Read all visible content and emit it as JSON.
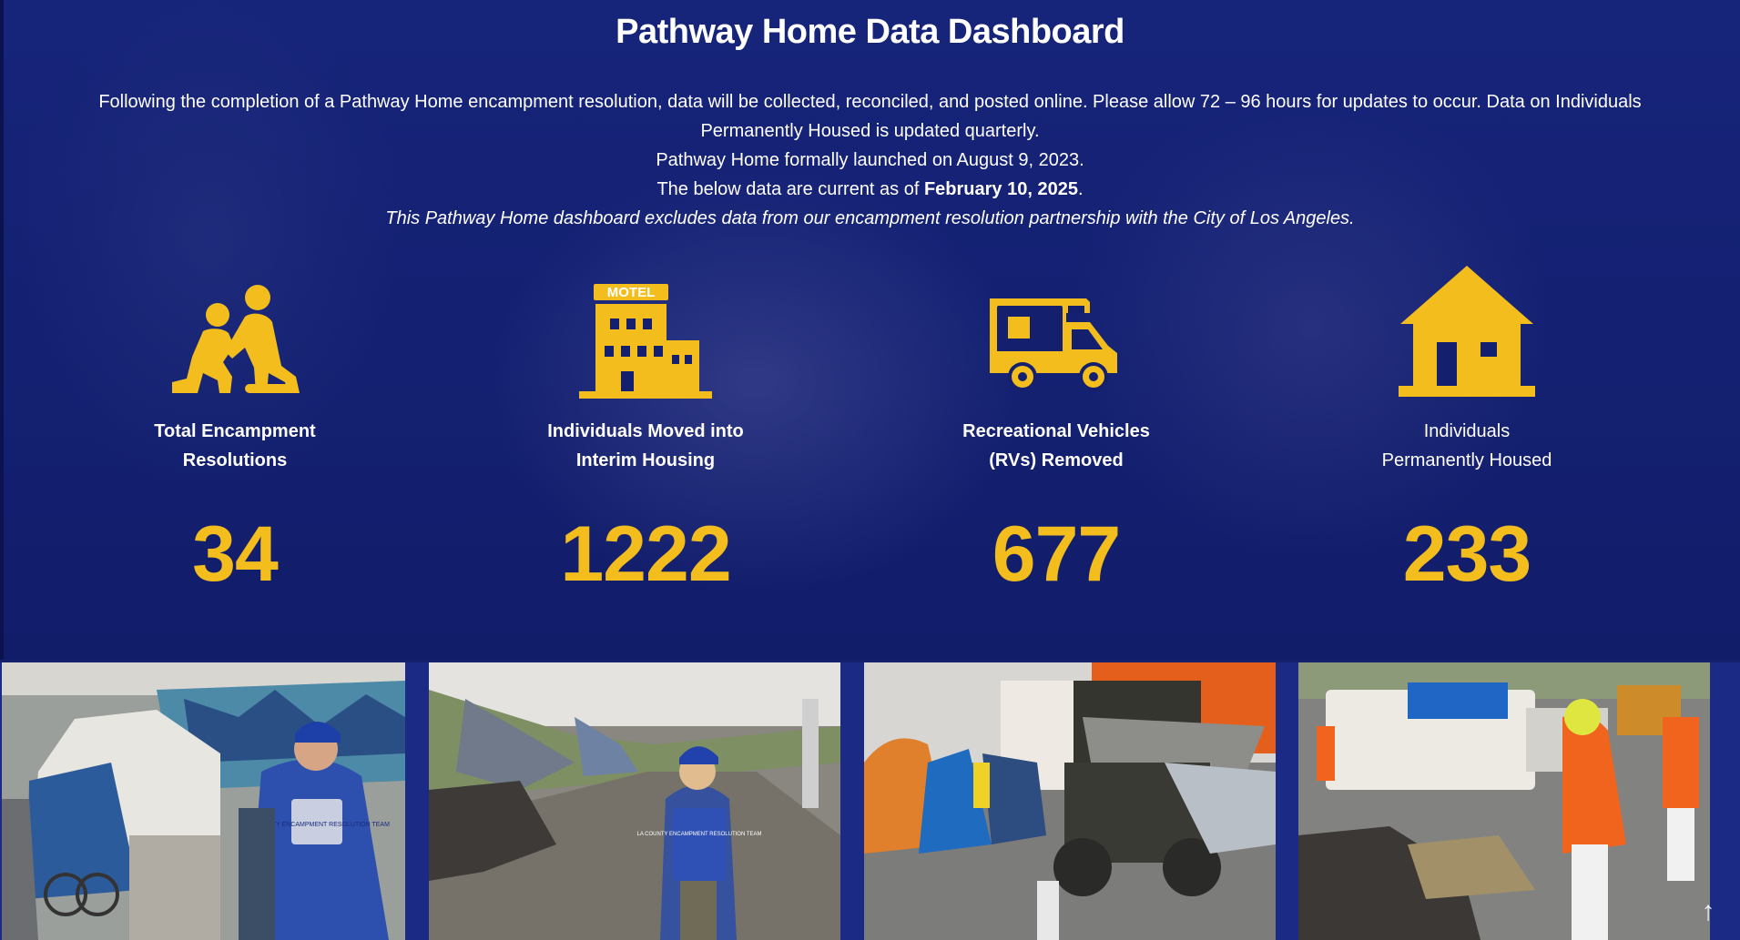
{
  "page": {
    "title": "Pathway Home Data Dashboard",
    "intro_line1": "Following the completion of a Pathway Home encampment resolution, data will be collected, reconciled, and posted online. Please allow 72 – 96 hours for updates to occur. Data on Individuals Permanently Housed is updated quarterly.",
    "intro_line2": "Pathway Home formally launched on August 9, 2023.",
    "intro_line3_prefix": "The below data are current as of ",
    "intro_line3_date": "February 10, 2025",
    "intro_line3_suffix": ".",
    "intro_line4": "This Pathway Home dashboard excludes data from our encampment resolution partnership with the City of Los Angeles."
  },
  "stats": [
    {
      "label_line1": "Total Encampment",
      "label_line2": "Resolutions",
      "value": "34",
      "icon": "helping-person-icon"
    },
    {
      "label_line1": "Individuals Moved into",
      "label_line2": "Interim Housing",
      "value": "1222",
      "icon": "motel-icon",
      "icon_text": "MOTEL"
    },
    {
      "label_line1": "Recreational Vehicles",
      "label_line2": "(RVs) Removed",
      "value": "677",
      "icon": "rv-icon"
    },
    {
      "label_line1": "Individuals",
      "label_line2": "Permanently Housed",
      "value": "233",
      "icon": "house-icon"
    }
  ],
  "photos": {
    "vest_text_1": "LA COUNTY ENCAMPMENT RESOLUTION TEAM",
    "vest_text_2": "LA COUNTY ENCAMPMENT RESOLUTION TEAM"
  },
  "colors": {
    "accent": "#f2bd1d",
    "background": "#14206e",
    "text": "#ffffff"
  },
  "scroll_top_icon": "arrow-up-icon"
}
